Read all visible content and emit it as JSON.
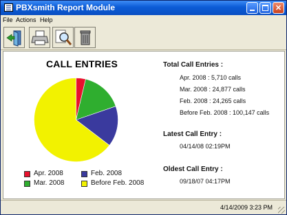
{
  "window": {
    "title": "PBXsmith Report Module"
  },
  "menu": {
    "items": [
      "File",
      "Actions",
      "Help"
    ]
  },
  "toolbar": {
    "icons": [
      "exit-door-icon",
      "print-icon",
      "zoom-icon",
      "trash-icon"
    ]
  },
  "chart": {
    "title": "CALL ENTRIES",
    "legend": [
      {
        "label": "Apr. 2008",
        "color": "#e8112d"
      },
      {
        "label": "Feb. 2008",
        "color": "#3a3a9e"
      },
      {
        "label": "Mar. 2008",
        "color": "#2fae2f"
      },
      {
        "label": "Before Feb. 2008",
        "color": "#f2f200"
      }
    ]
  },
  "chart_data": {
    "type": "pie",
    "title": "CALL ENTRIES",
    "categories": [
      "Apr. 2008",
      "Mar. 2008",
      "Feb. 2008",
      "Before Feb. 2008"
    ],
    "values": [
      5710,
      24877,
      24265,
      100147
    ],
    "colors": [
      "#e8112d",
      "#2fae2f",
      "#3a3a9e",
      "#f2f200"
    ]
  },
  "stats": {
    "total_heading": "Total Call Entries :",
    "total_lines": [
      "Apr. 2008 :  5,710 calls",
      "Mar. 2008 :  24,877 calls",
      "Feb. 2008 :  24,265 calls",
      "Before Feb. 2008 :  100,147 calls"
    ],
    "latest_heading": "Latest Call Entry :",
    "latest_value": "04/14/08 02:19PM",
    "oldest_heading": "Oldest Call Entry :",
    "oldest_value": "09/18/07 04:17PM"
  },
  "status": {
    "datetime": "4/14/2009  3:23 PM"
  }
}
